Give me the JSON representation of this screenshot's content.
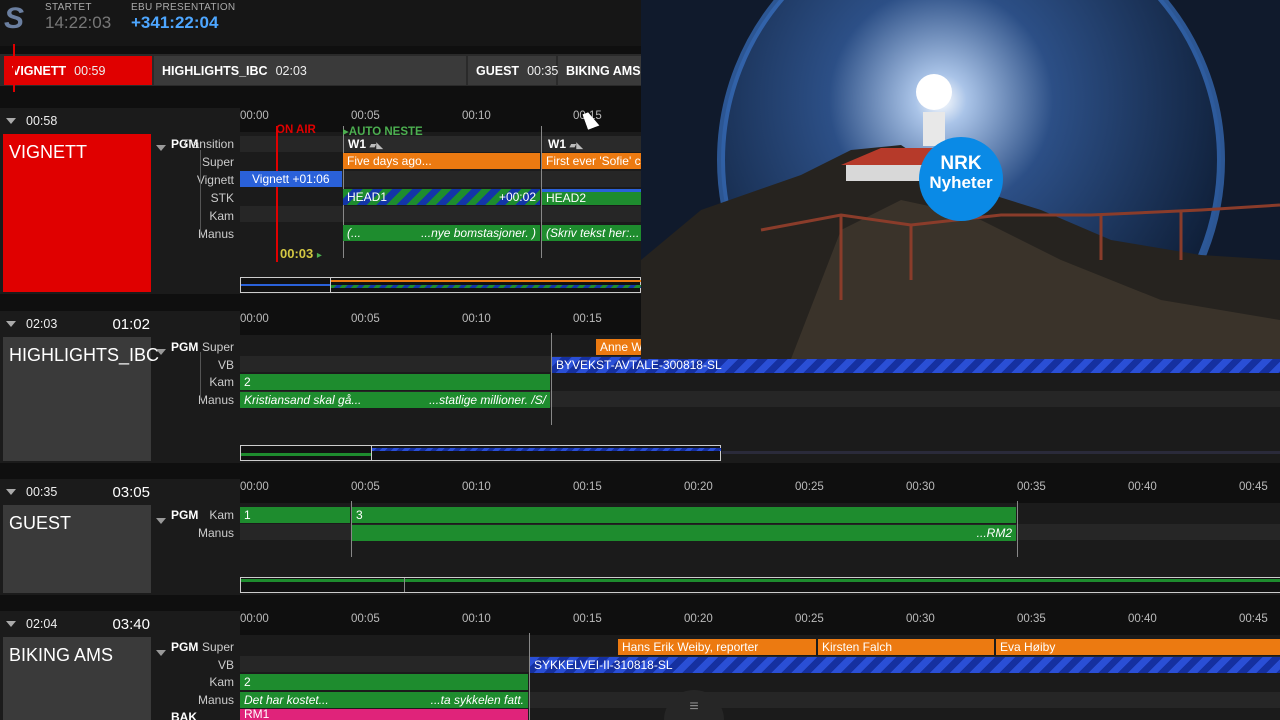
{
  "header": {
    "started_label": "STARTET",
    "started_value": "14:22:03",
    "presentation_label": "EBU PRESENTATION",
    "presentation_value": "+341:22:04",
    "logo": "S"
  },
  "strip": [
    {
      "name": "VIGNETT",
      "time": "00:59"
    },
    {
      "name": "HIGHLIGHTS_IBC",
      "time": "02:03"
    },
    {
      "name": "GUEST",
      "time": "00:35"
    },
    {
      "name": "BIKING AMS",
      "time": ""
    }
  ],
  "ruler": [
    "00:00",
    "00:05",
    "00:10",
    "00:15",
    "00:20",
    "00:25",
    "00:30",
    "00:35",
    "00:40",
    "00:45"
  ],
  "ruler_vignett": [
    "00:00",
    "00:05",
    "00:10",
    "00:15"
  ],
  "stories": {
    "vignett": {
      "duration": "00:58",
      "total": "",
      "title": "VIGNETT",
      "pgm": "PGM",
      "rows": [
        "Transition",
        "Super",
        "Vignett",
        "STK",
        "Kam",
        "Manus"
      ],
      "on_air": "ON AIR",
      "auto_neste": "AUTO NESTE",
      "w1a": "W1",
      "w1b": "W1",
      "super1": "Five days ago...",
      "super2": "First ever 'Sofie' c",
      "vignett_clip": "Vignett +01:06",
      "head1": "HEAD1",
      "head1_offset": "+00:02",
      "head2": "HEAD2",
      "manus1a": "(...",
      "manus1b": "...nye bomstasjoner. )",
      "manus2": "(Skriv tekst her:...",
      "countdown": "00:03"
    },
    "highlights": {
      "duration": "02:03",
      "total": "01:02",
      "title": "HIGHLIGHTS_IBC",
      "pgm": "PGM",
      "rows": [
        "Super",
        "VB",
        "Kam",
        "Manus"
      ],
      "super": "Anne W",
      "vb": "BYVEKST-AVTALE-300818-SL",
      "kam": "2",
      "manus_a": "Kristiansand skal gå...",
      "manus_b": "...statlige millioner. /S/"
    },
    "guest": {
      "duration": "00:35",
      "total": "03:05",
      "title": "GUEST",
      "pgm": "PGM",
      "rows": [
        "Kam",
        "Manus"
      ],
      "kam1": "1",
      "kam2": "3",
      "manus": "...RM2"
    },
    "biking": {
      "duration": "02:04",
      "total": "03:40",
      "title": "BIKING AMS",
      "pgm": "PGM",
      "rows": [
        "Super",
        "VB",
        "Kam",
        "Manus",
        "BAK"
      ],
      "super1": "Hans Erik Weiby, reporter",
      "super2": "Kirsten Falch",
      "super3": "Eva Høiby",
      "vb": "SYKKELVEI-II-310818-SL",
      "kam": "2",
      "manus_a": "Det har kostet...",
      "manus_b": "...ta sykkelen fatt.",
      "bak": "RM1"
    }
  },
  "preview": {
    "badge_line1": "NRK",
    "badge_line2": "Nyheter"
  },
  "colors": {
    "onair_red": "#e00000",
    "accent_blue": "#4da6ff",
    "clip_green": "#1e8c2e",
    "clip_orange": "#ec7a11",
    "clip_blue": "#2a61d9",
    "nrk_blue": "#0a8ae6"
  }
}
